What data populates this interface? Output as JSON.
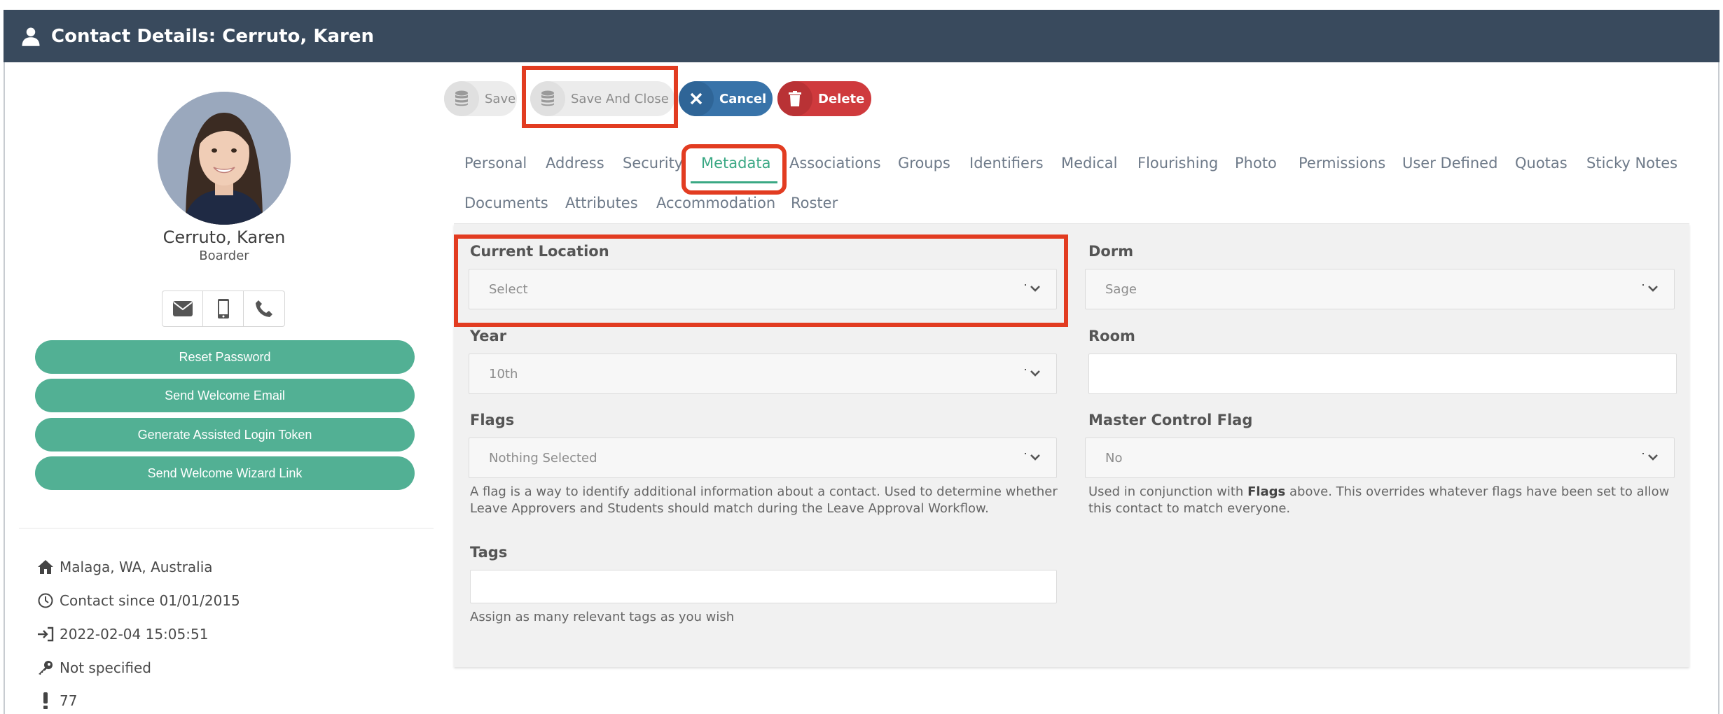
{
  "header": {
    "title": "Contact Details: Cerruto, Karen",
    "icon": "user-icon"
  },
  "profile": {
    "name": "Cerruto, Karen",
    "role": "Boarder",
    "contact_icons": [
      "envelope-icon",
      "mobile-icon",
      "phone-icon"
    ],
    "actions": [
      "Reset Password",
      "Send Welcome Email",
      "Generate Assisted Login Token",
      "Send Welcome Wizard Link"
    ],
    "info": [
      {
        "icon": "home-icon",
        "text": "Malaga, WA, Australia"
      },
      {
        "icon": "clock-icon",
        "text": "Contact since 01/01/2015"
      },
      {
        "icon": "sign-in-icon",
        "text": "2022-02-04 15:05:51"
      },
      {
        "icon": "key-icon",
        "text": "Not specified"
      },
      {
        "icon": "exclamation-icon",
        "text": "77"
      }
    ]
  },
  "toolbar": {
    "save": "Save",
    "save_close": "Save And Close",
    "cancel": "Cancel",
    "delete": "Delete"
  },
  "tabs": {
    "row1": [
      "Personal",
      "Address",
      "Security",
      "Metadata",
      "Associations",
      "Groups",
      "Identifiers",
      "Medical",
      "Flourishing",
      "Photo",
      "Permissions",
      "User Defined",
      "Quotas",
      "Sticky Notes"
    ],
    "row2": [
      "Documents",
      "Attributes",
      "Accommodation",
      "Roster"
    ],
    "active": "Metadata"
  },
  "form": {
    "current_location": {
      "label": "Current Location",
      "value": "Select"
    },
    "dorm": {
      "label": "Dorm",
      "value": "Sage"
    },
    "year": {
      "label": "Year",
      "value": "10th"
    },
    "room": {
      "label": "Room",
      "value": ""
    },
    "flags": {
      "label": "Flags",
      "value": "Nothing Selected",
      "help": "A flag is a way to identify additional information about a contact. Used to determine whether Leave Approvers and Students should match during the Leave Approval Workflow."
    },
    "master_control_flag": {
      "label": "Master Control Flag",
      "value": "No",
      "help_prefix": "Used in conjunction with",
      "help_bold": "Flags",
      "help_suffix": "above. This overrides whatever flags have been set to allow this contact to match everyone."
    },
    "tags": {
      "label": "Tags",
      "value": "",
      "help": "Assign as many relevant tags as you wish"
    }
  },
  "colors": {
    "header": "#394a5d",
    "accent_green": "#52b094",
    "tab_active": "#3aa884",
    "cancel": "#3873a9",
    "delete": "#cf3a3d",
    "highlight": "#e23c21"
  }
}
